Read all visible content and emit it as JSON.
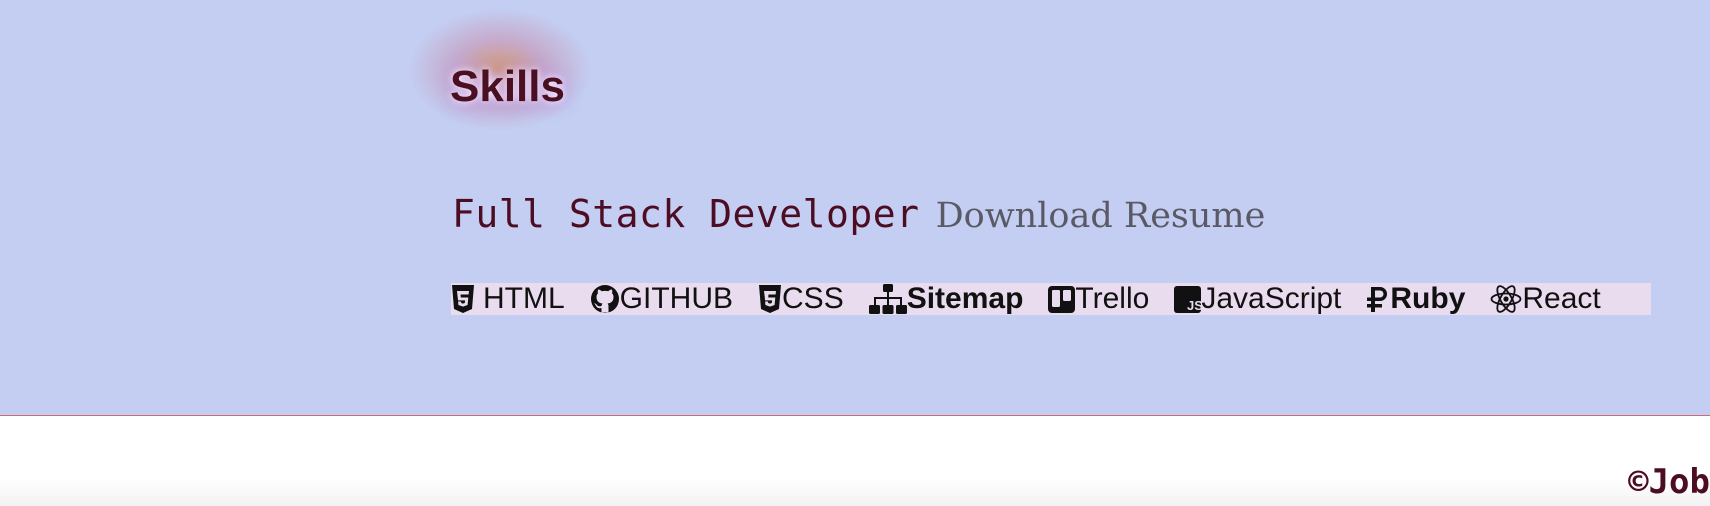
{
  "skills_section": {
    "title": "Skills",
    "role": "Full Stack Developer",
    "download_link": "Download Resume",
    "items": [
      {
        "label": "HTML",
        "icon": "html5-icon"
      },
      {
        "label": "GITHUB",
        "icon": "github-icon"
      },
      {
        "label": "CSS",
        "icon": "css3-icon"
      },
      {
        "label": "Sitemap",
        "icon": "sitemap-icon"
      },
      {
        "label": "Trello",
        "icon": "trello-icon"
      },
      {
        "label": "JavaScript",
        "icon": "javascript-icon"
      },
      {
        "label": "Ruby",
        "icon": "ruble-icon"
      },
      {
        "label": "React",
        "icon": "react-icon"
      }
    ]
  },
  "footer": {
    "copyright": "©Job"
  },
  "colors": {
    "section_background": "#c3cef2",
    "accent_text": "#4d0c22",
    "skills_strip": "#e9dcef",
    "divider": "#d06a7a"
  }
}
